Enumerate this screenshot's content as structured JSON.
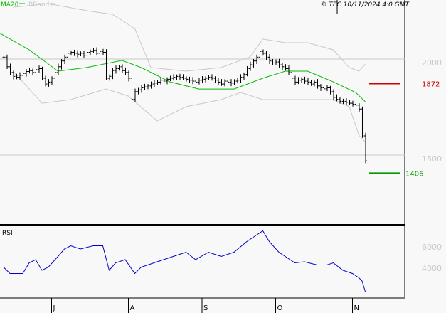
{
  "header": {
    "legend_ma": "MA20",
    "legend_bb": "BBands",
    "copyright": "© TEC 10/11/2024 4:0 GMT"
  },
  "colors": {
    "ma": "#00bb00",
    "bb": "#c8c8c8",
    "rsi": "#0000cc",
    "resistance": "#cc0000",
    "support": "#009900",
    "bars": "#000000"
  },
  "chart_data": {
    "type": "bar",
    "title": "OHLC bar chart with MA20, Bollinger Bands and RSI",
    "x_axis_ticks": [
      {
        "label": "J",
        "index": 15
      },
      {
        "label": "A",
        "index": 39
      },
      {
        "label": "S",
        "index": 62
      },
      {
        "label": "O",
        "index": 85
      },
      {
        "label": "N",
        "index": 109
      }
    ],
    "price_axis": {
      "ticks": [
        {
          "label": "2000",
          "value": 2000
        },
        {
          "label": "1500",
          "value": 1500
        }
      ]
    },
    "closes": [
      2010,
      1960,
      1930,
      1910,
      1905,
      1915,
      1925,
      1935,
      1940,
      1930,
      1945,
      1950,
      1900,
      1870,
      1880,
      1900,
      1930,
      1960,
      1990,
      2010,
      2030,
      2035,
      2030,
      2025,
      2030,
      2020,
      2035,
      2040,
      2045,
      2030,
      2040,
      2035,
      1900,
      1910,
      1940,
      1950,
      1960,
      1940,
      1930,
      1900,
      1790,
      1830,
      1840,
      1850,
      1855,
      1860,
      1870,
      1875,
      1880,
      1890,
      1885,
      1895,
      1900,
      1905,
      1910,
      1905,
      1900,
      1895,
      1890,
      1885,
      1880,
      1890,
      1895,
      1900,
      1905,
      1900,
      1890,
      1880,
      1870,
      1885,
      1880,
      1875,
      1885,
      1890,
      1905,
      1920,
      1950,
      1970,
      1990,
      2010,
      2040,
      2030,
      2010,
      1990,
      1980,
      1985,
      1970,
      1960,
      1950,
      1930,
      1900,
      1880,
      1890,
      1895,
      1885,
      1880,
      1870,
      1880,
      1860,
      1850,
      1845,
      1850,
      1830,
      1800,
      1790,
      1780,
      1780,
      1775,
      1770,
      1765,
      1760,
      1740,
      1600,
      1470
    ],
    "ma20": [
      [
        -1,
        2133
      ],
      [
        8,
        2048
      ],
      [
        17,
        1937
      ],
      [
        26,
        1956
      ],
      [
        37,
        1993
      ],
      [
        43,
        1956
      ],
      [
        52,
        1881
      ],
      [
        61,
        1844
      ],
      [
        72,
        1844
      ],
      [
        81,
        1900
      ],
      [
        88,
        1937
      ],
      [
        95,
        1937
      ],
      [
        103,
        1881
      ],
      [
        110,
        1826
      ],
      [
        113,
        1778
      ]
    ],
    "bb_upper": [
      [
        3,
        2270
      ],
      [
        14,
        2289
      ],
      [
        26,
        2252
      ],
      [
        34,
        2233
      ],
      [
        41,
        2159
      ],
      [
        46,
        1956
      ],
      [
        57,
        1937
      ],
      [
        68,
        1956
      ],
      [
        77,
        2011
      ],
      [
        81,
        2104
      ],
      [
        88,
        2085
      ],
      [
        95,
        2085
      ],
      [
        103,
        2048
      ],
      [
        108,
        1956
      ],
      [
        111,
        1937
      ],
      [
        113,
        1974
      ]
    ],
    "bb_lower": [
      [
        3,
        1937
      ],
      [
        12,
        1770
      ],
      [
        21,
        1789
      ],
      [
        32,
        1844
      ],
      [
        39,
        1807
      ],
      [
        48,
        1678
      ],
      [
        57,
        1752
      ],
      [
        68,
        1789
      ],
      [
        74,
        1826
      ],
      [
        81,
        1789
      ],
      [
        88,
        1789
      ],
      [
        97,
        1789
      ],
      [
        103,
        1789
      ],
      [
        108,
        1752
      ],
      [
        111,
        1604
      ],
      [
        113,
        1567
      ]
    ],
    "levels": [
      {
        "label": "1872",
        "value": 1872,
        "kind": "resistance"
      },
      {
        "label": "1406",
        "value": 1406,
        "kind": "support"
      }
    ],
    "rsi": {
      "label": "RSI",
      "ticks": [
        {
          "label": "6000",
          "value": 60
        },
        {
          "label": "4000",
          "value": 40
        }
      ],
      "points": [
        [
          0,
          41
        ],
        [
          2,
          35
        ],
        [
          6,
          35
        ],
        [
          8,
          45
        ],
        [
          10,
          48
        ],
        [
          12,
          38
        ],
        [
          14,
          41
        ],
        [
          17,
          51
        ],
        [
          19,
          58
        ],
        [
          21,
          61
        ],
        [
          24,
          58
        ],
        [
          28,
          61
        ],
        [
          31,
          61
        ],
        [
          33,
          38
        ],
        [
          35,
          45
        ],
        [
          38,
          48
        ],
        [
          41,
          35
        ],
        [
          43,
          41
        ],
        [
          47,
          45
        ],
        [
          50,
          48
        ],
        [
          53,
          51
        ],
        [
          57,
          55
        ],
        [
          60,
          48
        ],
        [
          64,
          55
        ],
        [
          68,
          51
        ],
        [
          72,
          55
        ],
        [
          76,
          65
        ],
        [
          79,
          71
        ],
        [
          81,
          75
        ],
        [
          83,
          65
        ],
        [
          86,
          55
        ],
        [
          88,
          51
        ],
        [
          91,
          45
        ],
        [
          94,
          46
        ],
        [
          98,
          43
        ],
        [
          101,
          43
        ],
        [
          103,
          45
        ],
        [
          106,
          38
        ],
        [
          109,
          35
        ],
        [
          111,
          31
        ],
        [
          112,
          28
        ],
        [
          113,
          18
        ]
      ]
    }
  }
}
